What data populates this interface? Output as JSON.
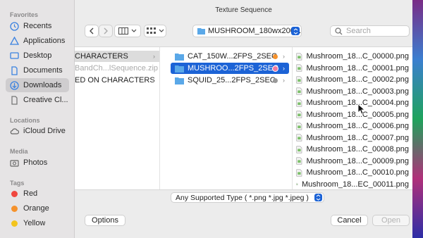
{
  "window": {
    "title": "Texture Sequence"
  },
  "sidebar": {
    "favorites_title": "Favorites",
    "favorites": [
      {
        "label": "Recents",
        "icon": "clock-icon"
      },
      {
        "label": "Applications",
        "icon": "applications-icon"
      },
      {
        "label": "Desktop",
        "icon": "desktop-icon"
      },
      {
        "label": "Documents",
        "icon": "document-icon"
      },
      {
        "label": "Downloads",
        "icon": "download-icon",
        "selected": true
      },
      {
        "label": "Creative Cl...",
        "icon": "file-icon"
      }
    ],
    "locations_title": "Locations",
    "locations": [
      {
        "label": "iCloud Drive",
        "icon": "cloud-icon"
      }
    ],
    "media_title": "Media",
    "media": [
      {
        "label": "Photos",
        "icon": "camera-icon"
      }
    ],
    "tags_title": "Tags",
    "tags": [
      {
        "label": "Red",
        "color": "#f0473f"
      },
      {
        "label": "Orange",
        "color": "#f5922c"
      },
      {
        "label": "Yellow",
        "color": "#f3c41d"
      }
    ]
  },
  "toolbar": {
    "location": "MUSHROOM_180wx200...",
    "search_placeholder": "Search"
  },
  "columns": {
    "col1": [
      {
        "label": "CHARACTERS",
        "selected": true,
        "chevron": true
      },
      {
        "label": "BandCh...lSequence.zip",
        "dim": true
      },
      {
        "label": "ED ON CHARACTERS",
        "chevron": true
      }
    ],
    "col2": [
      {
        "label": "CAT_150W...2FPS_2SEC",
        "tag": "#f5922c"
      },
      {
        "label": "MUSHROO...2FPS_2SEC",
        "tag": "#f07aa0",
        "selected": true
      },
      {
        "label": "SQUID_25...2FPS_2SEC",
        "tag": "#9a9a9a"
      }
    ],
    "col3": [
      "Mushroom_18...C_00000.png",
      "Mushroom_18...C_00001.png",
      "Mushroom_18...C_00002.png",
      "Mushroom_18...C_00003.png",
      "Mushroom_18...C_00004.png",
      "Mushroom_18...C_00005.png",
      "Mushroom_18...C_00006.png",
      "Mushroom_18...C_00007.png",
      "Mushroom_18...C_00008.png",
      "Mushroom_18...C_00009.png",
      "Mushroom_18...C_00010.png",
      "Mushroom_18...EC_00011.png"
    ]
  },
  "filter": {
    "value": "Any Supported Type ( *.png *.jpg *.jpeg )"
  },
  "footer": {
    "options_label": "Options",
    "cancel_label": "Cancel",
    "open_label": "Open"
  }
}
